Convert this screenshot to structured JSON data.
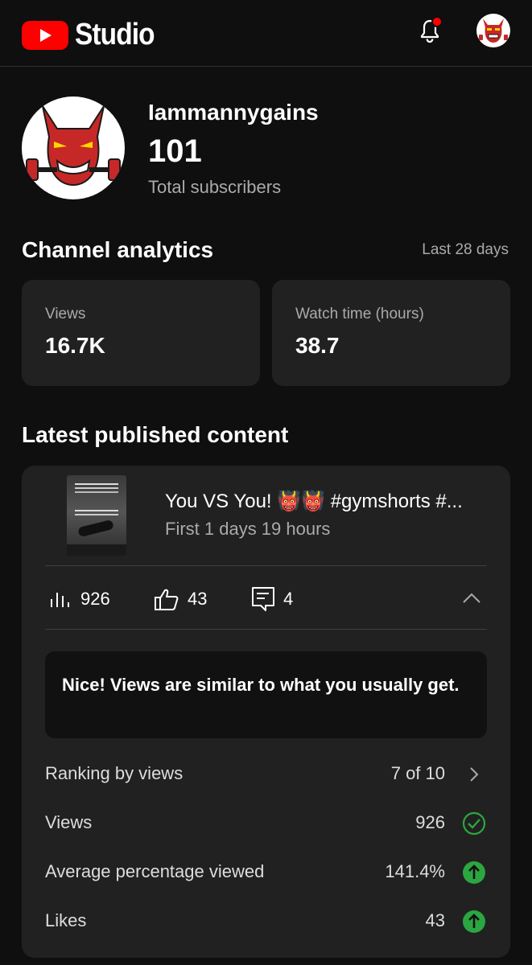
{
  "header": {
    "app_name": "Studio",
    "icons": [
      "youtube-logo-icon",
      "notification-bell-icon",
      "account-avatar"
    ]
  },
  "channel": {
    "name": "Iammannygains",
    "subscriber_count": "101",
    "subscriber_label": "Total subscribers"
  },
  "analytics": {
    "title": "Channel analytics",
    "period": "Last 28 days",
    "cards": [
      {
        "label": "Views",
        "value": "16.7K"
      },
      {
        "label": "Watch time (hours)",
        "value": "38.7"
      }
    ]
  },
  "latest": {
    "title": "Latest published content",
    "video_title": "You VS You! 👹👹 #gymshorts #...",
    "video_age": "First 1 days 19 hours",
    "metrics": {
      "views": "926",
      "likes": "43",
      "comments": "4"
    },
    "insight": "Nice! Views are similar to what you usually get.",
    "rows": [
      {
        "label": "Ranking by views",
        "value": "7 of 10",
        "icon": "chevron-right-icon"
      },
      {
        "label": "Views",
        "value": "926",
        "icon": "check-circle-icon"
      },
      {
        "label": "Average percentage viewed",
        "value": "141.4%",
        "icon": "arrow-up-circle-icon"
      },
      {
        "label": "Likes",
        "value": "43",
        "icon": "arrow-up-circle-icon"
      }
    ]
  },
  "colors": {
    "background": "#0f0f0f",
    "card": "#212121",
    "brand_red": "#ff0000",
    "positive_green": "#2ba640"
  }
}
